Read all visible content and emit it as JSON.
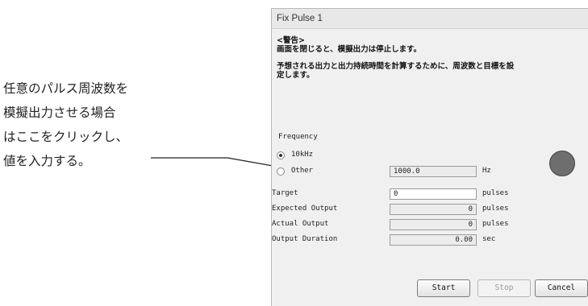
{
  "annotation": {
    "lines": [
      "任意のパルス周波数を",
      "模擬出力させる場合",
      "はここをクリックし、",
      "値を入力する。"
    ]
  },
  "dialog": {
    "title": "Fix Pulse 1",
    "warning_heading": "<警告>",
    "warning_line1": "画面を閉じると、模擬出力は停止します。",
    "warning_line2": "予想される出力と出力持続時間を計算するために、周波数と目標を設",
    "warning_line3": "定します。",
    "frequency_label": "Frequency",
    "option_10khz": "10kHz",
    "option_other": "Other",
    "selected_option": "10kHz",
    "other_value": "1000.0",
    "other_unit": "Hz",
    "target_label": "Target",
    "target_value": "0",
    "target_unit": "pulses",
    "expected_label": "Expected Output",
    "expected_value": "0",
    "expected_unit": "pulses",
    "actual_label": "Actual Output",
    "actual_value": "0",
    "actual_unit": "pulses",
    "duration_label": "Output Duration",
    "duration_value": "0.00",
    "duration_unit": "sec",
    "start_label": "Start",
    "stop_label": "Stop",
    "cancel_label": "Cancel"
  }
}
